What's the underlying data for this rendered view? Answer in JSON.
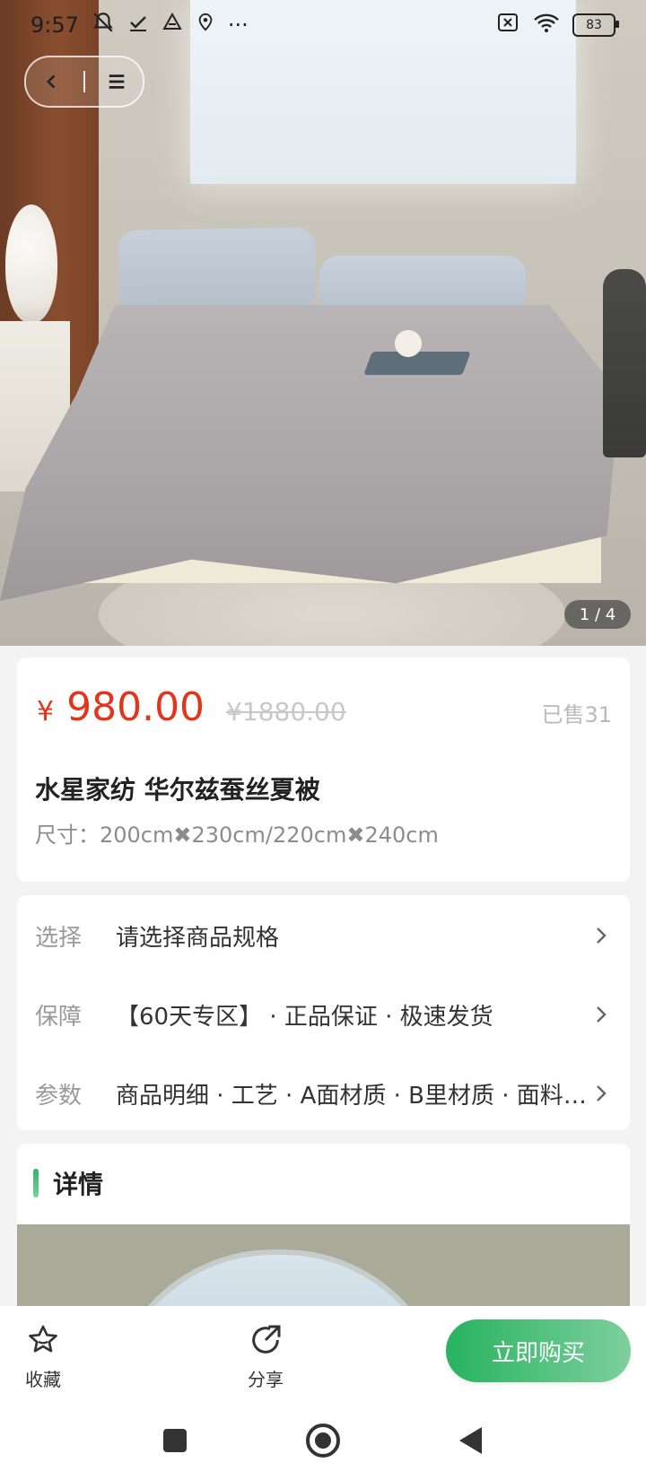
{
  "status_bar": {
    "time": "9:57",
    "more": "···",
    "battery": "83"
  },
  "hero": {
    "counter": "1 / 4"
  },
  "product": {
    "currency": "¥",
    "price": "980.00",
    "original_price": "¥1880.00",
    "sold": "已售31",
    "title": "水星家纺 华尔兹蚕丝夏被",
    "size": "尺寸：200cm✖230cm/220cm✖240cm"
  },
  "options": [
    {
      "label": "选择",
      "text": "请选择商品规格"
    },
    {
      "label": "保障",
      "text": "【60天专区】 · 正品保证 · 极速发货"
    },
    {
      "label": "参数",
      "text": "商品明细 · 工艺 · A面材质 · B里材质 · 面料成分"
    }
  ],
  "detail": {
    "title": "详情"
  },
  "bottom": {
    "favorite": "收藏",
    "share": "分享",
    "buy": "立即购买"
  },
  "colors": {
    "price": "#e2351b",
    "accent": "#27b35f"
  }
}
